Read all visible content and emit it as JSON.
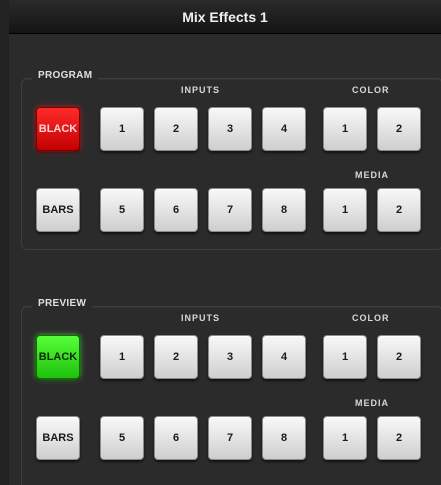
{
  "window": {
    "title": "Mix Effects 1"
  },
  "program": {
    "label": "PROGRAM",
    "inputs_label": "INPUTS",
    "color_label": "COLOR",
    "media_label": "MEDIA",
    "black": "BLACK",
    "bars": "BARS",
    "inputs_row1": [
      "1",
      "2",
      "3",
      "4"
    ],
    "inputs_row2": [
      "5",
      "6",
      "7",
      "8"
    ],
    "color": [
      "1",
      "2"
    ],
    "media": [
      "1",
      "2"
    ],
    "active_color": "#e31313"
  },
  "preview": {
    "label": "PREVIEW",
    "inputs_label": "INPUTS",
    "color_label": "COLOR",
    "media_label": "MEDIA",
    "black": "BLACK",
    "bars": "BARS",
    "inputs_row1": [
      "1",
      "2",
      "3",
      "4"
    ],
    "inputs_row2": [
      "5",
      "6",
      "7",
      "8"
    ],
    "color": [
      "1",
      "2"
    ],
    "media": [
      "1",
      "2"
    ],
    "active_color": "#33e01e"
  }
}
